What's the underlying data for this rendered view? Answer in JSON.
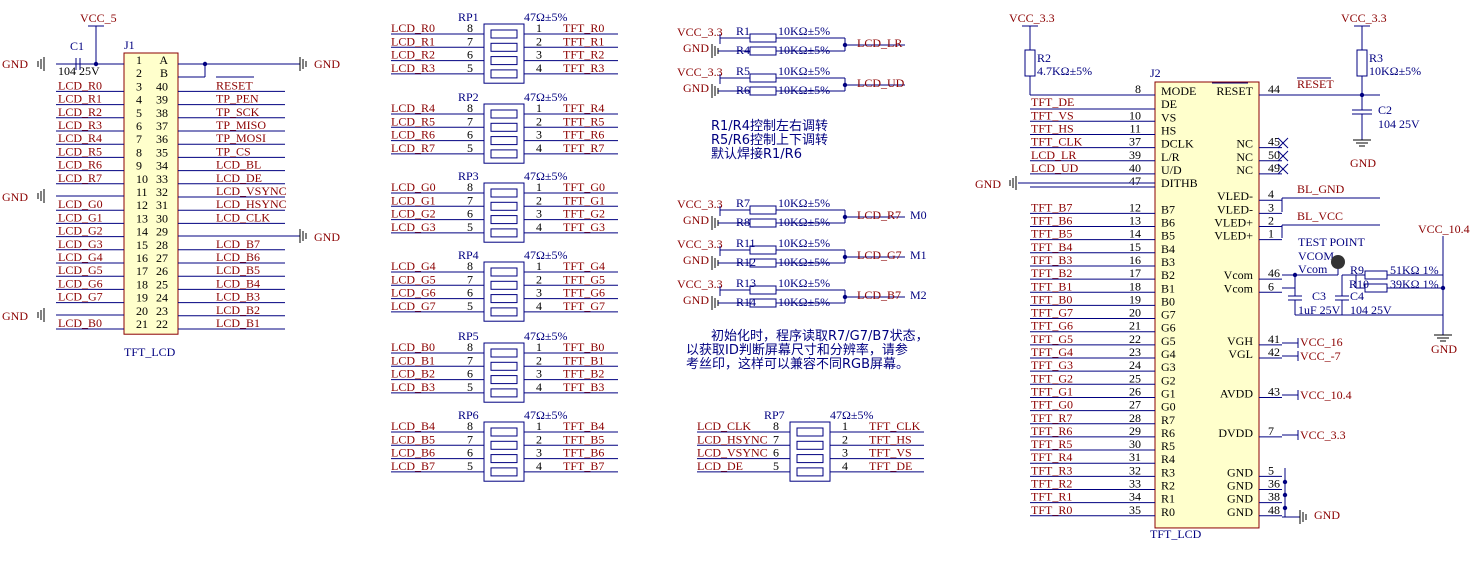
{
  "j1": {
    "ref": "J1",
    "name": "TFT_LCD",
    "rows": [
      {
        "l": "1",
        "r": "A",
        "ln": "",
        "rn": ""
      },
      {
        "l": "2",
        "r": "B",
        "ln": "",
        "rn": ""
      },
      {
        "l": "3",
        "r": "40",
        "ln": "LCD_R0",
        "rn": "RESET"
      },
      {
        "l": "4",
        "r": "39",
        "ln": "LCD_R1",
        "rn": "TP_PEN"
      },
      {
        "l": "5",
        "r": "38",
        "ln": "LCD_R2",
        "rn": "TP_SCK"
      },
      {
        "l": "6",
        "r": "37",
        "ln": "LCD_R3",
        "rn": "TP_MISO"
      },
      {
        "l": "7",
        "r": "36",
        "ln": "LCD_R4",
        "rn": "TP_MOSI"
      },
      {
        "l": "8",
        "r": "35",
        "ln": "LCD_R5",
        "rn": "TP_CS"
      },
      {
        "l": "9",
        "r": "34",
        "ln": "LCD_R6",
        "rn": "LCD_BL"
      },
      {
        "l": "10",
        "r": "33",
        "ln": "LCD_R7",
        "rn": "LCD_DE"
      },
      {
        "l": "11",
        "r": "32",
        "ln": "",
        "rn": "LCD_VSYNC"
      },
      {
        "l": "12",
        "r": "31",
        "ln": "LCD_G0",
        "rn": "LCD_HSYNC"
      },
      {
        "l": "13",
        "r": "30",
        "ln": "LCD_G1",
        "rn": "LCD_CLK"
      },
      {
        "l": "14",
        "r": "29",
        "ln": "LCD_G2",
        "rn": ""
      },
      {
        "l": "15",
        "r": "28",
        "ln": "LCD_G3",
        "rn": "LCD_B7"
      },
      {
        "l": "16",
        "r": "27",
        "ln": "LCD_G4",
        "rn": "LCD_B6"
      },
      {
        "l": "17",
        "r": "26",
        "ln": "LCD_G5",
        "rn": "LCD_B5"
      },
      {
        "l": "18",
        "r": "25",
        "ln": "LCD_G6",
        "rn": "LCD_B4"
      },
      {
        "l": "19",
        "r": "24",
        "ln": "LCD_G7",
        "rn": "LCD_B3"
      },
      {
        "l": "20",
        "r": "23",
        "ln": "",
        "rn": "LCD_B2"
      },
      {
        "l": "21",
        "r": "22",
        "ln": "LCD_B0",
        "rn": "LCD_B1"
      }
    ]
  },
  "c1": {
    "ref": "C1",
    "value": "104 25V"
  },
  "power": {
    "vcc5": "VCC_5",
    "vcc33": "VCC_3.3",
    "gnd": "GND",
    "vcc104": "VCC_10.4",
    "vcc16": "VCC_16",
    "vccm7": "VCC_-7"
  },
  "rpacks": [
    {
      "ref": "RP1",
      "value": "47Ω±5%",
      "in": [
        "LCD_R0",
        "LCD_R1",
        "LCD_R2",
        "LCD_R3"
      ],
      "out": [
        "TFT_R0",
        "TFT_R1",
        "TFT_R2",
        "TFT_R3"
      ],
      "lp": [
        "8",
        "7",
        "6",
        "5"
      ],
      "rp": [
        "1",
        "2",
        "3",
        "4"
      ]
    },
    {
      "ref": "RP2",
      "value": "47Ω±5%",
      "in": [
        "LCD_R4",
        "LCD_R5",
        "LCD_R6",
        "LCD_R7"
      ],
      "out": [
        "TFT_R4",
        "TFT_R5",
        "TFT_R6",
        "TFT_R7"
      ],
      "lp": [
        "8",
        "7",
        "6",
        "5"
      ],
      "rp": [
        "1",
        "2",
        "3",
        "4"
      ]
    },
    {
      "ref": "RP3",
      "value": "47Ω±5%",
      "in": [
        "LCD_G0",
        "LCD_G1",
        "LCD_G2",
        "LCD_G3"
      ],
      "out": [
        "TFT_G0",
        "TFT_G1",
        "TFT_G2",
        "TFT_G3"
      ],
      "lp": [
        "8",
        "7",
        "6",
        "5"
      ],
      "rp": [
        "1",
        "2",
        "3",
        "4"
      ]
    },
    {
      "ref": "RP4",
      "value": "47Ω±5%",
      "in": [
        "LCD_G4",
        "LCD_G5",
        "LCD_G6",
        "LCD_G7"
      ],
      "out": [
        "TFT_G4",
        "TFT_G5",
        "TFT_G6",
        "TFT_G7"
      ],
      "lp": [
        "8",
        "7",
        "6",
        "5"
      ],
      "rp": [
        "1",
        "2",
        "3",
        "4"
      ]
    },
    {
      "ref": "RP5",
      "value": "47Ω±5%",
      "in": [
        "LCD_B0",
        "LCD_B1",
        "LCD_B2",
        "LCD_B3"
      ],
      "out": [
        "TFT_B0",
        "TFT_B1",
        "TFT_B2",
        "TFT_B3"
      ],
      "lp": [
        "8",
        "7",
        "6",
        "5"
      ],
      "rp": [
        "1",
        "2",
        "3",
        "4"
      ]
    },
    {
      "ref": "RP6",
      "value": "47Ω±5%",
      "in": [
        "LCD_B4",
        "LCD_B5",
        "LCD_B6",
        "LCD_B7"
      ],
      "out": [
        "TFT_B4",
        "TFT_B5",
        "TFT_B6",
        "TFT_B7"
      ],
      "lp": [
        "8",
        "7",
        "6",
        "5"
      ],
      "rp": [
        "1",
        "2",
        "3",
        "4"
      ]
    },
    {
      "ref": "RP7",
      "value": "47Ω±5%",
      "in": [
        "LCD_CLK",
        "LCD_HSYNC",
        "LCD_VSYNC",
        "LCD_DE"
      ],
      "out": [
        "TFT_CLK",
        "TFT_HS",
        "TFT_VS",
        "TFT_DE"
      ],
      "lp": [
        "8",
        "7",
        "6",
        "5"
      ],
      "rp": [
        "1",
        "2",
        "3",
        "4"
      ]
    }
  ],
  "straps": [
    {
      "ra": "R1",
      "rb": "R4",
      "va": "10KΩ±5%",
      "vb": "10KΩ±5%",
      "net": "LCD_LR",
      "mode": ""
    },
    {
      "ra": "R5",
      "rb": "R6",
      "va": "10KΩ±5%",
      "vb": "10KΩ±5%",
      "net": "LCD_UD",
      "mode": ""
    },
    {
      "ra": "R7",
      "rb": "R8",
      "va": "10KΩ±5%",
      "vb": "10KΩ±5%",
      "net": "LCD_R7",
      "mode": "M0"
    },
    {
      "ra": "R11",
      "rb": "R12",
      "va": "10KΩ±5%",
      "vb": "10KΩ±5%",
      "net": "LCD_G7",
      "mode": "M1"
    },
    {
      "ra": "R13",
      "rb": "R14",
      "va": "10KΩ±5%",
      "vb": "10KΩ±5%",
      "net": "LCD_B7",
      "mode": "M2"
    }
  ],
  "notes": {
    "strap": [
      "R1/R4控制左右调转",
      "R5/R6控制上下调转",
      "默认焊接R1/R6"
    ],
    "init": [
      "初始化时，程序读取R7/G7/B7状态，",
      "以获取ID判断屏幕尺寸和分辨率，请参",
      "考丝印，这样可以兼容不同RGB屏幕。"
    ]
  },
  "r2": {
    "ref": "R2",
    "value": "4.7KΩ±5%"
  },
  "r3": {
    "ref": "R3",
    "value": "10KΩ±5%"
  },
  "c2": {
    "ref": "C2",
    "value": "104 25V"
  },
  "r9": {
    "ref": "R9",
    "value": "51KΩ 1%"
  },
  "r10": {
    "ref": "R10",
    "value": "39KΩ 1%"
  },
  "c3": {
    "ref": "C3",
    "value": "1uF 25V"
  },
  "c4": {
    "ref": "C4",
    "value": "104 25V"
  },
  "testpoint": {
    "label": "TEST POINT",
    "name": "VCOM",
    "net": "Vcom"
  },
  "j2": {
    "ref": "J2",
    "name": "TFT_LCD",
    "left": [
      {
        "pin": "8",
        "name": "MODE",
        "net": ""
      },
      {
        "pin": "",
        "name": "DE",
        "net": "TFT_DE"
      },
      {
        "pin": "10",
        "name": "VS",
        "net": "TFT_VS"
      },
      {
        "pin": "11",
        "name": "HS",
        "net": "TFT_HS"
      },
      {
        "pin": "37",
        "name": "DCLK",
        "net": "TFT_CLK"
      },
      {
        "pin": "39",
        "name": "L/R",
        "net": "LCD_LR"
      },
      {
        "pin": "40",
        "name": "U/D",
        "net": "LCD_UD"
      },
      {
        "pin": "47",
        "name": "DITHB",
        "net": ""
      },
      {
        "pin": "",
        "name": "",
        "net": ""
      },
      {
        "pin": "12",
        "name": "B7",
        "net": "TFT_B7"
      },
      {
        "pin": "13",
        "name": "B6",
        "net": "TFT_B6"
      },
      {
        "pin": "14",
        "name": "B5",
        "net": "TFT_B5"
      },
      {
        "pin": "15",
        "name": "B4",
        "net": "TFT_B4"
      },
      {
        "pin": "16",
        "name": "B3",
        "net": "TFT_B3"
      },
      {
        "pin": "17",
        "name": "B2",
        "net": "TFT_B2"
      },
      {
        "pin": "18",
        "name": "B1",
        "net": "TFT_B1"
      },
      {
        "pin": "19",
        "name": "B0",
        "net": "TFT_B0"
      },
      {
        "pin": "20",
        "name": "G7",
        "net": "TFT_G7"
      },
      {
        "pin": "21",
        "name": "G6",
        "net": "TFT_G6"
      },
      {
        "pin": "22",
        "name": "G5",
        "net": "TFT_G5"
      },
      {
        "pin": "23",
        "name": "G4",
        "net": "TFT_G4"
      },
      {
        "pin": "24",
        "name": "G3",
        "net": "TFT_G3"
      },
      {
        "pin": "25",
        "name": "G2",
        "net": "TFT_G2"
      },
      {
        "pin": "26",
        "name": "G1",
        "net": "TFT_G1"
      },
      {
        "pin": "27",
        "name": "G0",
        "net": "TFT_G0"
      },
      {
        "pin": "28",
        "name": "R7",
        "net": "TFT_R7"
      },
      {
        "pin": "29",
        "name": "R6",
        "net": "TFT_R6"
      },
      {
        "pin": "30",
        "name": "R5",
        "net": "TFT_R5"
      },
      {
        "pin": "31",
        "name": "R4",
        "net": "TFT_R4"
      },
      {
        "pin": "32",
        "name": "R3",
        "net": "TFT_R3"
      },
      {
        "pin": "33",
        "name": "R2",
        "net": "TFT_R2"
      },
      {
        "pin": "34",
        "name": "R1",
        "net": "TFT_R1"
      },
      {
        "pin": "35",
        "name": "R0",
        "net": "TFT_R0"
      }
    ],
    "right": [
      {
        "row": 0,
        "pin": "44",
        "name": "RESET",
        "net": "RESET"
      },
      {
        "row": 4,
        "pin": "45",
        "name": "NC",
        "net": ""
      },
      {
        "row": 5,
        "pin": "50",
        "name": "NC",
        "net": ""
      },
      {
        "row": 6,
        "pin": "49",
        "name": "NC",
        "net": ""
      },
      {
        "row": 8,
        "pin": "4",
        "name": "VLED-",
        "net": "BL_GND"
      },
      {
        "row": 9,
        "pin": "3",
        "name": "VLED-",
        "net": ""
      },
      {
        "row": 10,
        "pin": "2",
        "name": "VLED+",
        "net": "BL_VCC"
      },
      {
        "row": 11,
        "pin": "1",
        "name": "VLED+",
        "net": ""
      },
      {
        "row": 14,
        "pin": "46",
        "name": "Vcom",
        "net": ""
      },
      {
        "row": 15,
        "pin": "6",
        "name": "Vcom",
        "net": ""
      },
      {
        "row": 19,
        "pin": "41",
        "name": "VGH",
        "net": ""
      },
      {
        "row": 20,
        "pin": "42",
        "name": "VGL",
        "net": ""
      },
      {
        "row": 23,
        "pin": "43",
        "name": "AVDD",
        "net": ""
      },
      {
        "row": 26,
        "pin": "7",
        "name": "DVDD",
        "net": ""
      },
      {
        "row": 29,
        "pin": "5",
        "name": "GND",
        "net": ""
      },
      {
        "row": 30,
        "pin": "36",
        "name": "GND",
        "net": ""
      },
      {
        "row": 31,
        "pin": "38",
        "name": "GND",
        "net": ""
      },
      {
        "row": 32,
        "pin": "48",
        "name": "GND",
        "net": ""
      }
    ]
  }
}
